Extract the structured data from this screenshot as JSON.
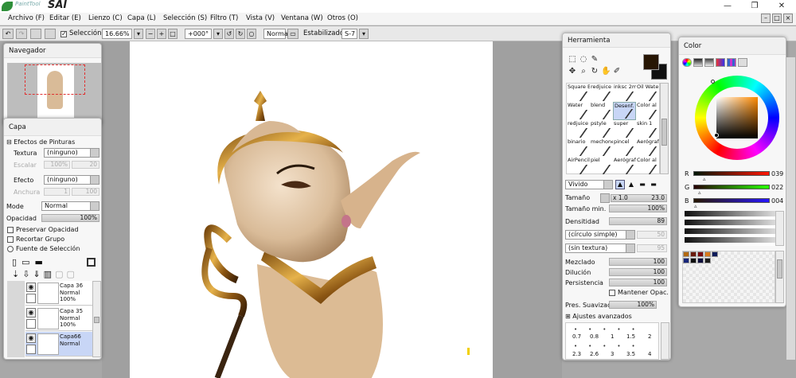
{
  "app": {
    "logo_text": "PaintTool",
    "logo_sai": "SAI"
  },
  "window_controls": {
    "minimize": "—",
    "maximize": "❐",
    "close": "✕"
  },
  "menu": [
    "Archivo (F)",
    "Editar (E)",
    "Lienzo (C)",
    "Capa (L)",
    "Selección (S)",
    "Filtro (T)",
    "Vista (V)",
    "Ventana (W)",
    "Otros (O)"
  ],
  "toolbar": {
    "selection_label": "Selección",
    "selection_checked": true,
    "zoom": "16.66%",
    "rotation": "+000°",
    "blend": "Normal",
    "stabilizer_label": "Estabilizador",
    "stabilizer_value": "S-7"
  },
  "navigator": {
    "title": "Navegador"
  },
  "layer_panel": {
    "title": "Capa",
    "effects_title": "Efectos de Pinturas",
    "texture_label": "Textura",
    "texture_value": "(ninguno)",
    "scale_label": "Escalar",
    "scale_value": "100%",
    "scale_value2": "20",
    "effect_label": "Efecto",
    "effect_value": "(ninguno)",
    "width_label": "Anchura",
    "width_value": "1",
    "width_value2": "100",
    "mode_label": "Mode",
    "mode_value": "Normal",
    "opacity_label": "Opacidad",
    "opacity_value": "100%",
    "checks": [
      "Preservar Opacidad",
      "Recortar Grupo",
      "Fuente de Selección"
    ],
    "layers": [
      {
        "name": "Capa 36",
        "mode": "Normal",
        "opacity": "100%"
      },
      {
        "name": "Capa 35",
        "mode": "Normal",
        "opacity": "100%"
      },
      {
        "name": "Capa66",
        "mode": "Normal",
        "opacity": ""
      }
    ]
  },
  "tool_panel": {
    "title": "Herramienta",
    "brushes": [
      [
        "Square Brush",
        "redjuice",
        "inksc 2mm",
        "Oil Water"
      ],
      [
        "Water",
        "blend",
        "Desenf.",
        "Color al"
      ],
      [
        "redjuice",
        "pstyle",
        "super",
        "skin 1"
      ],
      [
        "binario",
        "mechone",
        "pincel",
        "Aerógrafo"
      ],
      [
        "AirPencil Pencil",
        "piel",
        "Aerógrafo",
        "Color al"
      ]
    ],
    "mode_value": "Vivido",
    "size_label": "Tamaño",
    "size_mult": "x 1.0",
    "size_value": "23.0",
    "min_size_label": "Tamaño min.",
    "min_size_value": "100%",
    "density_label": "Densitidad",
    "density_value": "89",
    "shape_value": "(círculo simple)",
    "shape_amount": "50",
    "texture_value": "(sin textura)",
    "texture_amount": "95",
    "mix_label": "Mezclado",
    "mix_value": "100",
    "dilution_label": "Dilución",
    "dilution_value": "100",
    "persistence_label": "Persistencia",
    "persistence_value": "100",
    "keep_opacity_label": "Mantener Opac.",
    "smoothing_label": "Pres. Suavizado",
    "smoothing_value": "100%",
    "advanced_label": "Ajustes avanzados",
    "size_presets_row1": [
      "0.7",
      "0.8",
      "1",
      "1.5",
      "2"
    ],
    "size_presets_row2": [
      "2.3",
      "2.6",
      "3",
      "3.5",
      "4"
    ]
  },
  "color_panel": {
    "title": "Color",
    "r_label": "R",
    "r_value": "039",
    "g_label": "G",
    "g_value": "022",
    "b_label": "B",
    "b_value": "004",
    "foreground_color": "#271604"
  }
}
